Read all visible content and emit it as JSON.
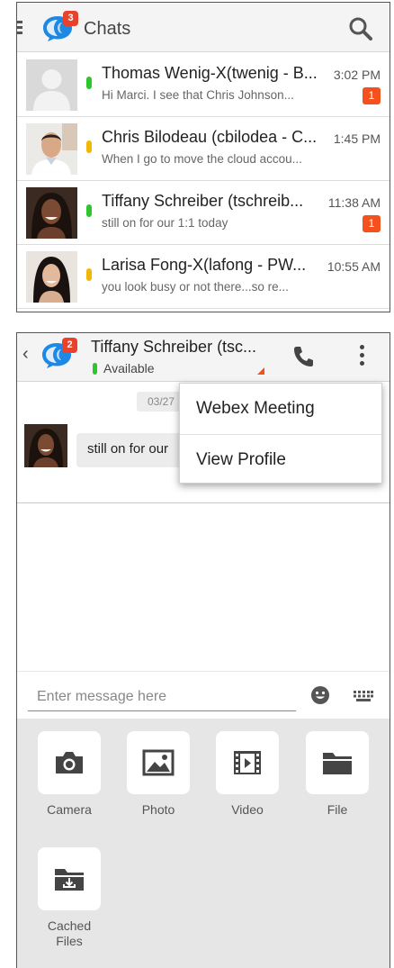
{
  "chats_screen": {
    "title": "Chats",
    "badge_count": "3",
    "chats": [
      {
        "name": "Thomas Wenig-X(twenig - B...",
        "preview": "Hi Marci.  I see that Chris Johnson...",
        "time": "3:02 PM",
        "unread": "1",
        "presence": "green"
      },
      {
        "name": "Chris Bilodeau (cbilodea - C...",
        "preview": "When I go to move the cloud accou...",
        "time": "1:45 PM",
        "unread": "",
        "presence": "yellow"
      },
      {
        "name": "Tiffany Schreiber (tschreib...",
        "preview": "still on for our 1:1 today",
        "time": "11:38 AM",
        "unread": "1",
        "presence": "green"
      },
      {
        "name": "Larisa Fong-X(lafong - PW...",
        "preview": "you look busy or not there...so re...",
        "time": "10:55 AM",
        "unread": "",
        "presence": "yellow"
      }
    ]
  },
  "conversation_screen": {
    "badge_count": "2",
    "contact_name": "Tiffany Schreiber (tsc...",
    "status": "Available",
    "date_chip": "03/27",
    "message": "still on for our",
    "menu": [
      "Webex Meeting",
      "View Profile"
    ],
    "composer": {
      "placeholder": "Enter message here"
    },
    "attachments": [
      {
        "label": "Camera",
        "icon": "camera-icon"
      },
      {
        "label": "Photo",
        "icon": "photo-icon"
      },
      {
        "label": "Video",
        "icon": "video-icon"
      },
      {
        "label": "File",
        "icon": "folder-icon"
      },
      {
        "label": "Cached Files",
        "icon": "cached-files-icon"
      }
    ]
  },
  "colors": {
    "badge": "#e8412c",
    "unread": "#f4511e",
    "presence_green": "#2ec52e",
    "presence_yellow": "#f2b705",
    "logo_blue": "#1e88e5"
  }
}
